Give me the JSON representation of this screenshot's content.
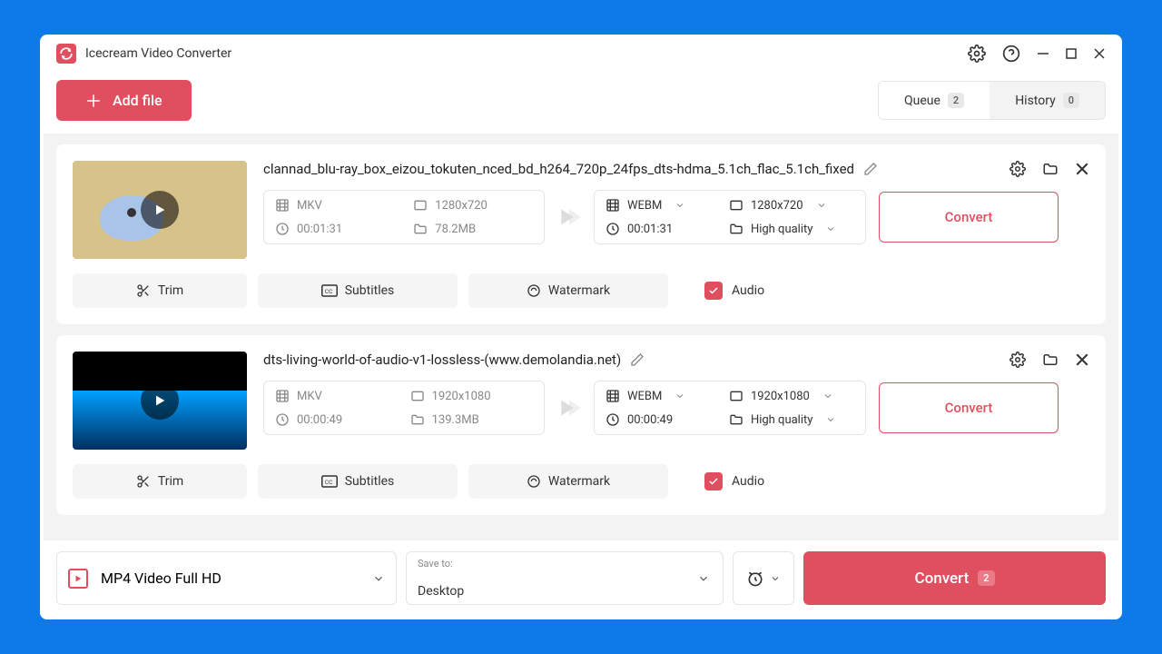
{
  "app": {
    "title": "Icecream Video Converter"
  },
  "toolbar": {
    "add_label": "Add file",
    "queue_label": "Queue",
    "queue_count": "2",
    "history_label": "History",
    "history_count": "0"
  },
  "items": [
    {
      "title": "clannad_blu-ray_box_eizou_tokuten_nced_bd_h264_720p_24fps_dts-hdma_5.1ch_flac_5.1ch_fixed",
      "src_format": "MKV",
      "src_res": "1280x720",
      "src_dur": "00:01:31",
      "src_size": "78.2MB",
      "out_format": "WEBM",
      "out_res": "1280x720",
      "out_dur": "00:01:31",
      "out_quality": "High quality",
      "convert": "Convert",
      "trim": "Trim",
      "subtitles": "Subtitles",
      "watermark": "Watermark",
      "audio": "Audio"
    },
    {
      "title": "dts-living-world-of-audio-v1-lossless-(www.demolandia.net)",
      "src_format": "MKV",
      "src_res": "1920x1080",
      "src_dur": "00:00:49",
      "src_size": "139.3MB",
      "out_format": "WEBM",
      "out_res": "1920x1080",
      "out_dur": "00:00:49",
      "out_quality": "High quality",
      "convert": "Convert",
      "trim": "Trim",
      "subtitles": "Subtitles",
      "watermark": "Watermark",
      "audio": "Audio"
    }
  ],
  "footer": {
    "preset": "MP4 Video Full HD",
    "saveto_label": "Save to:",
    "saveto_value": "Desktop",
    "convert_label": "Convert",
    "convert_count": "2"
  }
}
